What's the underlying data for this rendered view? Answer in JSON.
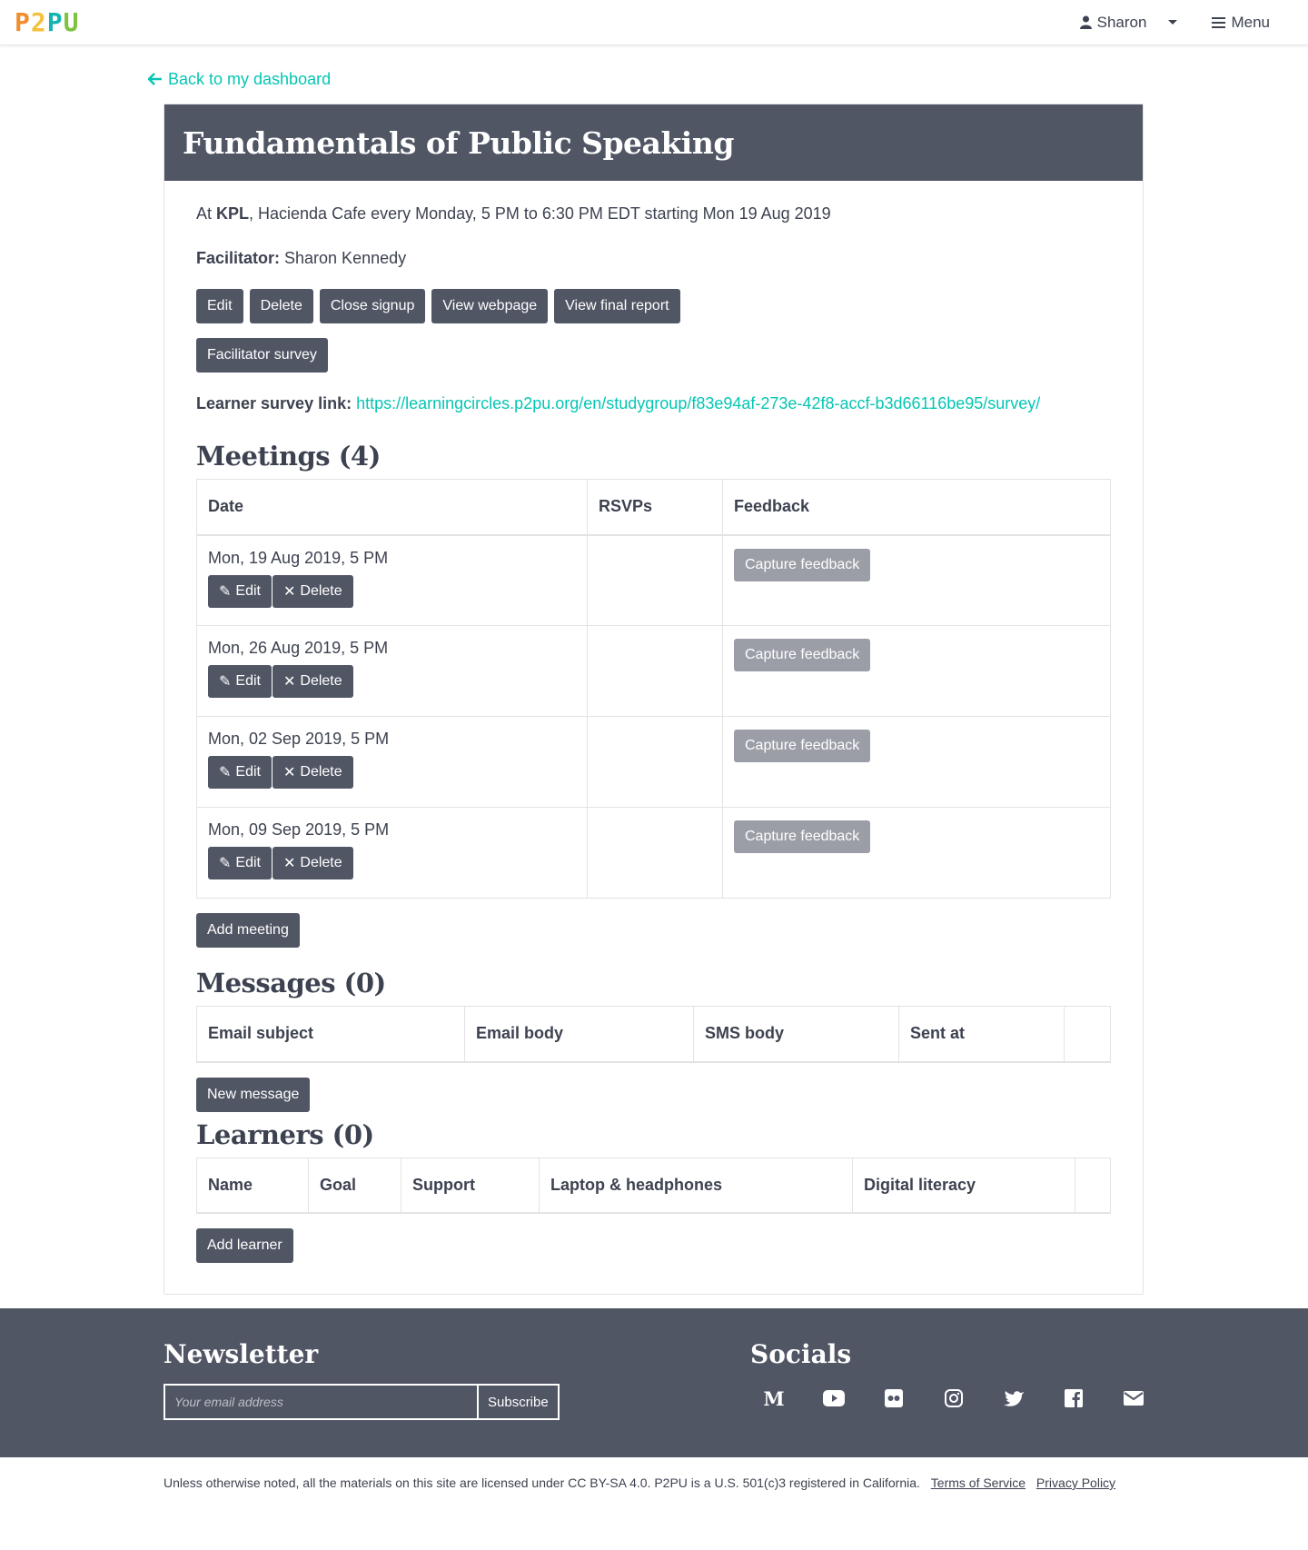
{
  "nav": {
    "logo": [
      "P",
      "2",
      "P",
      "U"
    ],
    "user": "Sharon",
    "menu": "Menu"
  },
  "back_link": "Back to my dashboard",
  "course": {
    "title": "Fundamentals of Public Speaking",
    "at": "At ",
    "venue": "KPL",
    "schedule": ", Hacienda Cafe every Monday, 5 PM to 6:30 PM EDT starting Mon 19 Aug 2019",
    "facilitator_label": "Facilitator:",
    "facilitator": " Sharon Kennedy",
    "buttons": [
      "Edit",
      "Delete",
      "Close signup",
      "View webpage",
      "View final report"
    ],
    "survey_button": "Facilitator survey",
    "learner_link_label": "Learner survey link:",
    "learner_link": "https://learningcircles.p2pu.org/en/studygroup/f83e94af-273e-42f8-accf-b3d66116be95/survey/"
  },
  "meetings": {
    "heading": "Meetings (4)",
    "columns": [
      "Date",
      "RSVPs",
      "Feedback"
    ],
    "rows": [
      {
        "date": "Mon, 19 Aug 2019, 5 PM",
        "rsvps": "",
        "feedback": "Capture feedback"
      },
      {
        "date": "Mon, 26 Aug 2019, 5 PM",
        "rsvps": "",
        "feedback": "Capture feedback"
      },
      {
        "date": "Mon, 02 Sep 2019, 5 PM",
        "rsvps": "",
        "feedback": "Capture feedback"
      },
      {
        "date": "Mon, 09 Sep 2019, 5 PM",
        "rsvps": "",
        "feedback": "Capture feedback"
      }
    ],
    "edit_label": "Edit",
    "delete_label": "Delete",
    "add_button": "Add meeting"
  },
  "messages": {
    "heading": "Messages (0)",
    "columns": [
      "Email subject",
      "Email body",
      "SMS body",
      "Sent at",
      ""
    ],
    "new_button": "New message"
  },
  "learners": {
    "heading": "Learners (0)",
    "columns": [
      "Name",
      "Goal",
      "Support",
      "Laptop & headphones",
      "Digital literacy",
      ""
    ],
    "add_button": "Add learner"
  },
  "footer": {
    "newsletter_title": "Newsletter",
    "email_placeholder": "Your email address",
    "subscribe": "Subscribe",
    "socials_title": "Socials",
    "social_icons": [
      "medium-icon",
      "youtube-icon",
      "flickr-icon",
      "instagram-icon",
      "twitter-icon",
      "facebook-icon",
      "email-icon"
    ],
    "legal": "Unless otherwise noted, all the materials on this site are licensed under CC BY-SA 4.0.  P2PU is a U.S. 501(c)3 registered in California.",
    "terms": "Terms of Service",
    "privacy": "Privacy Policy"
  },
  "colors": {
    "accent": "#05c6b4",
    "dark": "#515665",
    "muted_button": "#9b9ea7"
  }
}
